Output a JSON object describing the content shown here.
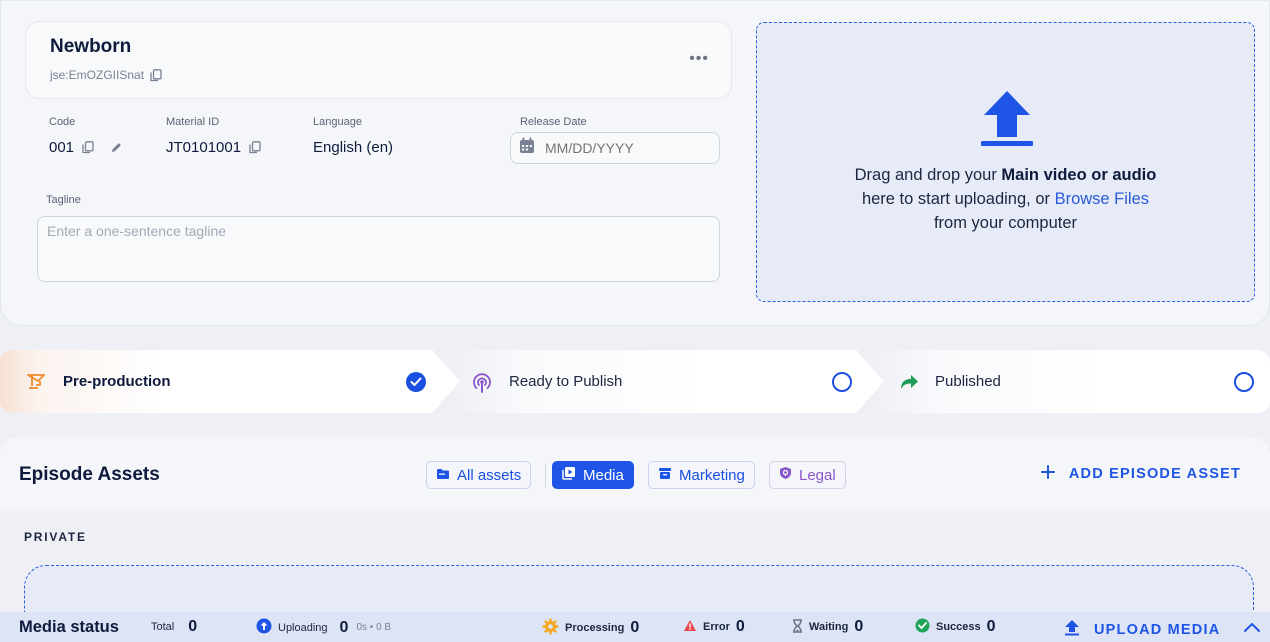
{
  "episode": {
    "title": "Newborn",
    "id": "jse:EmOZGIISnat",
    "more_label": "•••"
  },
  "fields": {
    "code": {
      "label": "Code",
      "value": "001"
    },
    "material_id": {
      "label": "Material ID",
      "value": "JT0101001"
    },
    "language": {
      "label": "Language",
      "value": "English (en)"
    },
    "release_date": {
      "label": "Release Date",
      "placeholder": "MM/DD/YYYY"
    },
    "tagline": {
      "label": "Tagline",
      "placeholder": "Enter a one-sentence tagline"
    }
  },
  "upload": {
    "text_before": "Drag and drop your ",
    "text_bold": "Main video or audio",
    "text_line2_before": "here to start uploading, or ",
    "browse_link": "Browse Files",
    "text_line3": "from your computer"
  },
  "stepper": [
    {
      "label": "Pre-production",
      "status": "complete",
      "icon": "crane-icon"
    },
    {
      "label": "Ready to Publish",
      "status": "pending",
      "icon": "podcast-icon"
    },
    {
      "label": "Published",
      "status": "pending",
      "icon": "share-arrow-icon"
    }
  ],
  "assets": {
    "title": "Episode Assets",
    "filters": [
      {
        "label": "All assets",
        "active": false
      },
      {
        "label": "Media",
        "active": true
      },
      {
        "label": "Marketing",
        "active": false
      },
      {
        "label": "Legal",
        "active": false
      }
    ],
    "add_label": "ADD EPISODE ASSET",
    "private_label": "PRIVATE"
  },
  "media_status": {
    "title": "Media status",
    "total": {
      "label": "Total",
      "value": "0"
    },
    "uploading": {
      "label": "Uploading",
      "value": "0",
      "sub": "0s • 0 B"
    },
    "processing": {
      "label": "Processing",
      "value": "0"
    },
    "error": {
      "label": "Error",
      "value": "0"
    },
    "waiting": {
      "label": "Waiting",
      "value": "0"
    },
    "success": {
      "label": "Success",
      "value": "0"
    },
    "upload_label": "UPLOAD MEDIA"
  },
  "colors": {
    "accent": "#1f55e6",
    "complete": "#1a4fe0",
    "published_arrow": "#1f9d55",
    "processing": "#f5a623",
    "error": "#e5484d",
    "success": "#22a35a",
    "legal": "#8a57c8"
  }
}
